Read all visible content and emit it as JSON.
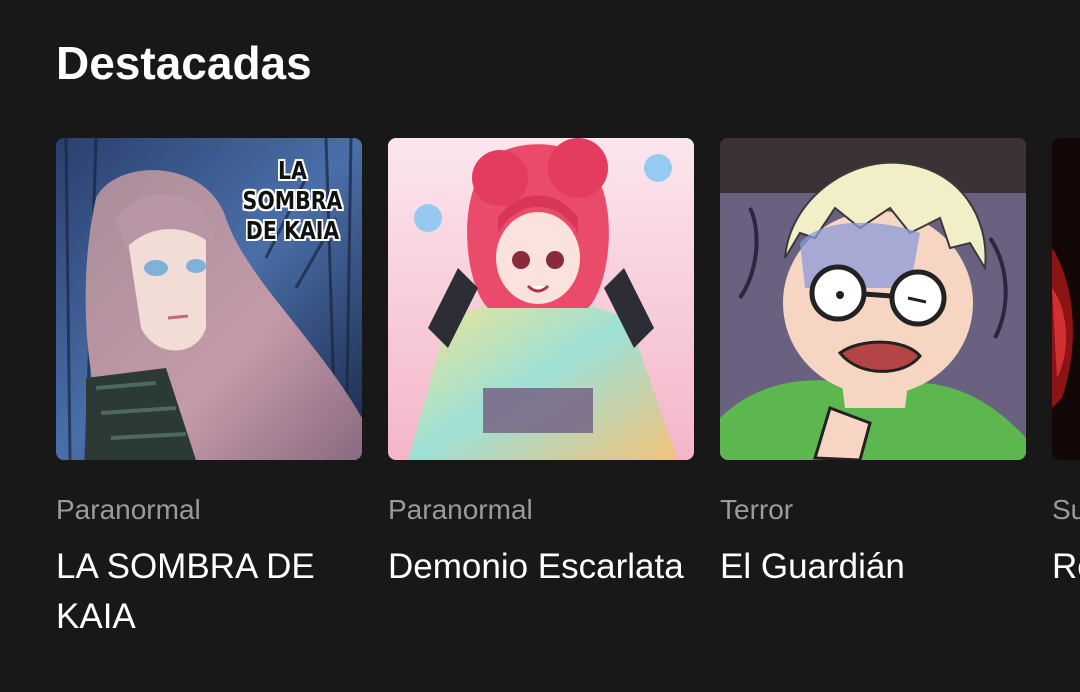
{
  "section": {
    "title": "Destacadas"
  },
  "cards": [
    {
      "genre": "Paranormal",
      "title": "LA SOMBRA DE KAIA",
      "cover_text": "LA SOMBRA DE KAIA",
      "cover_icon": "forest-girl-portrait"
    },
    {
      "genre": "Paranormal",
      "title": "Demonio Escarlata",
      "cover_icon": "red-haired-demon-girl"
    },
    {
      "genre": "Terror",
      "title": "El Guardián",
      "cover_icon": "scared-boy-glasses"
    },
    {
      "genre": "Su",
      "title": "Re",
      "cover_icon": "red-hair-partial"
    }
  ]
}
